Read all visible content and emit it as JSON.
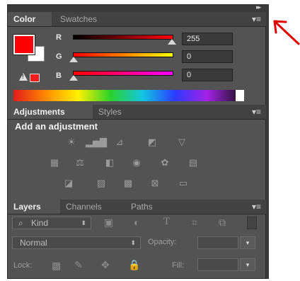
{
  "color_panel": {
    "tabs": [
      "Color",
      "Swatches"
    ],
    "channels": [
      {
        "label": "R",
        "value": "255"
      },
      {
        "label": "G",
        "value": "0"
      },
      {
        "label": "B",
        "value": "0"
      }
    ],
    "warning_icon_glyph": "!",
    "colors": {
      "foreground": "#ff0000",
      "background": "#ffffff"
    }
  },
  "adjustments_panel": {
    "tabs": [
      "Adjustments",
      "Styles"
    ],
    "heading": "Add an adjustment",
    "icons": [
      [
        "brightness-contrast-icon",
        "levels-icon",
        "curves-icon",
        "exposure-icon",
        "vibrance-icon"
      ],
      [
        "hue-saturation-icon",
        "color-balance-icon",
        "black-white-icon",
        "photo-filter-icon",
        "channel-mixer-icon",
        "color-lookup-icon"
      ],
      [
        "invert-icon",
        "posterize-icon",
        "threshold-icon",
        "selective-color-icon",
        "gradient-map-icon"
      ]
    ]
  },
  "layers_panel": {
    "tabs": [
      "Layers",
      "Channels",
      "Paths"
    ],
    "filter": {
      "label": "Kind"
    },
    "blend_mode": "Normal",
    "opacity_label": "Opacity:",
    "lock_label": "Lock:",
    "fill_label": "Fill:"
  }
}
